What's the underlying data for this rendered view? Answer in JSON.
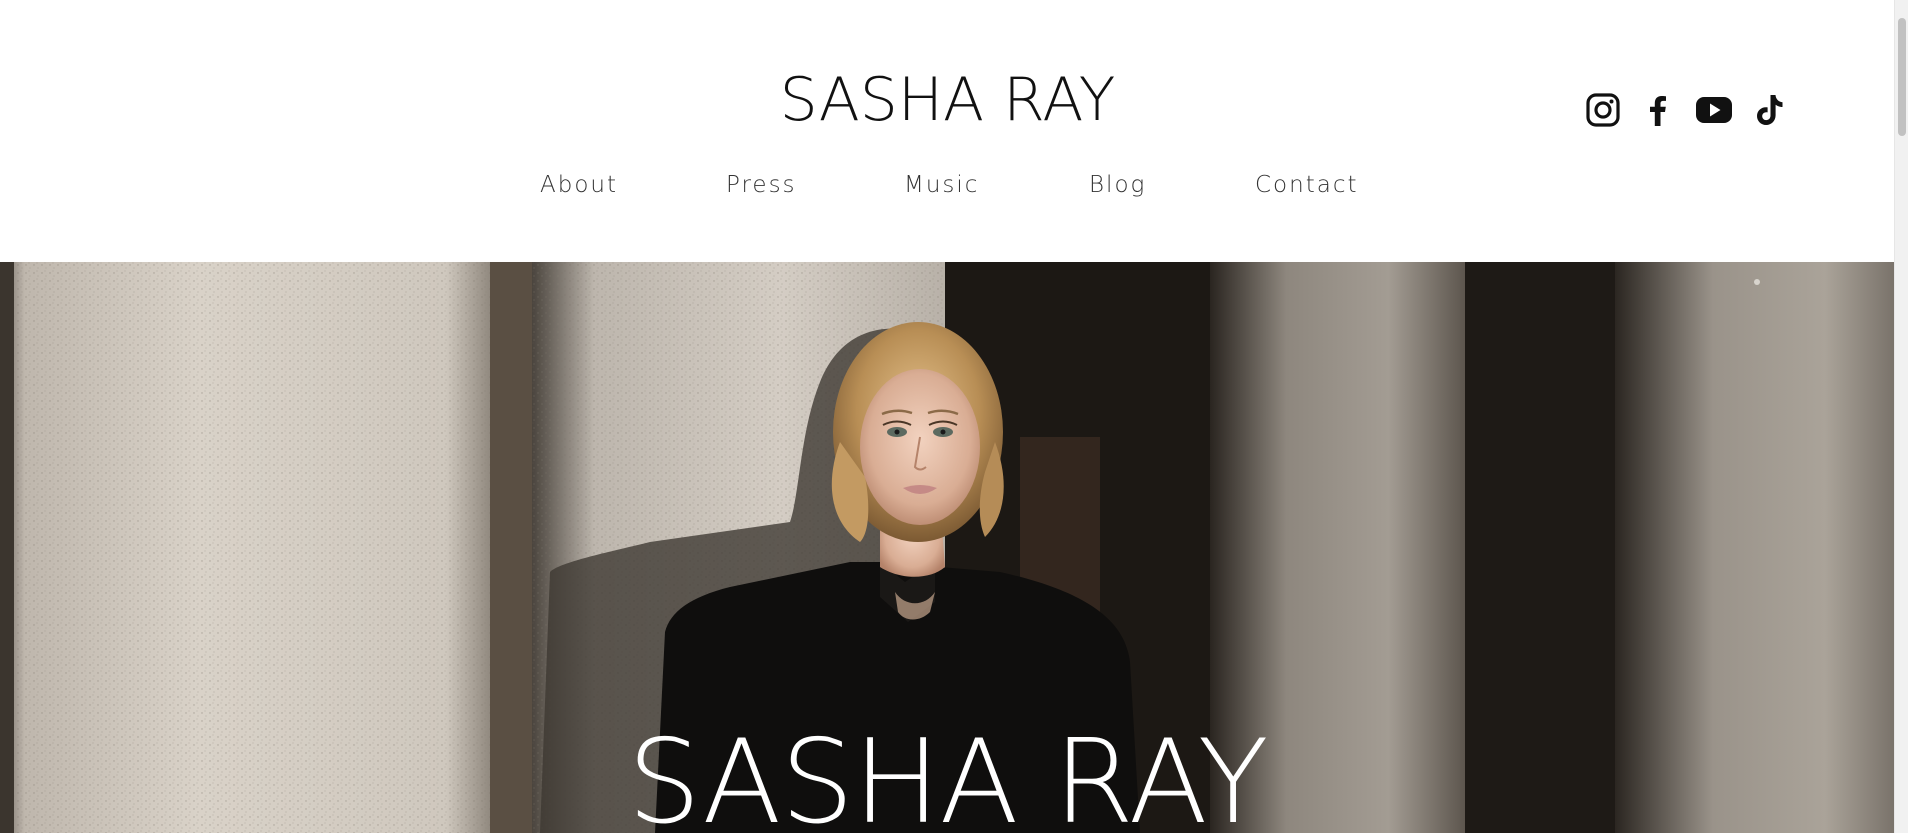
{
  "header": {
    "site_title": "SASHA RAY",
    "nav": [
      {
        "label": "About"
      },
      {
        "label": "Press"
      },
      {
        "label": "Music"
      },
      {
        "label": "Blog"
      },
      {
        "label": "Contact"
      }
    ],
    "social": [
      {
        "icon": "instagram-icon"
      },
      {
        "icon": "facebook-icon"
      },
      {
        "icon": "youtube-icon"
      },
      {
        "icon": "tiktok-icon"
      }
    ]
  },
  "hero": {
    "title": "SASHA RAY"
  },
  "colors": {
    "text": "#111111",
    "nav_text": "#333333",
    "hero_text": "#ffffff",
    "background": "#ffffff"
  }
}
